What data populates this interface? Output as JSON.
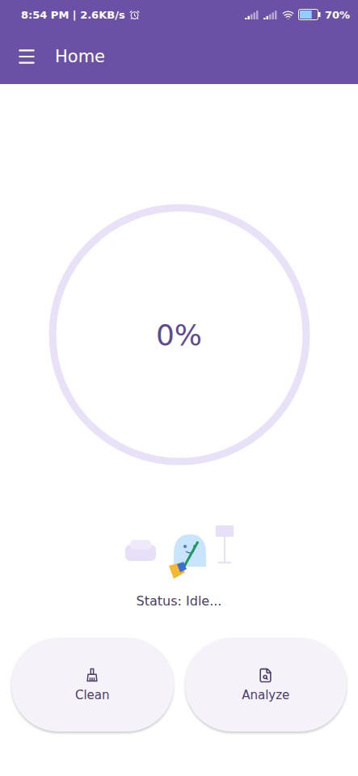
{
  "status_bar": {
    "time": "8:54 PM | 2.6KB/s",
    "battery": "70%",
    "battery_level": 0.7
  },
  "app_bar": {
    "title": "Home"
  },
  "progress": {
    "label": "0%",
    "level": 0
  },
  "status": {
    "text": "Status: Idle..."
  },
  "buttons": [
    {
      "label": "Clean",
      "kind": "clean"
    },
    {
      "label": "Analyze",
      "kind": "analyze"
    }
  ]
}
